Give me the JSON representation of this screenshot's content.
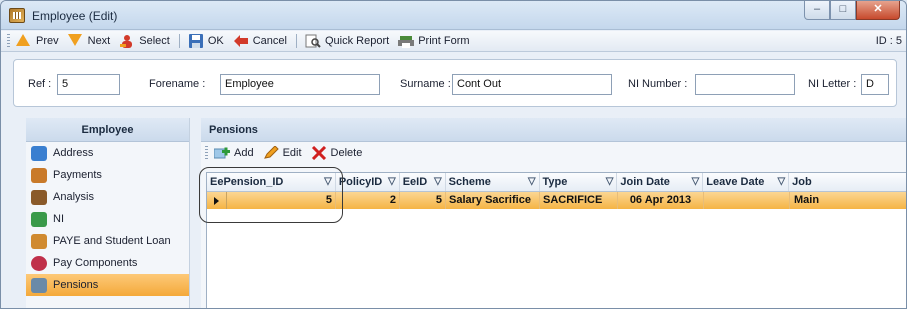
{
  "window": {
    "title": "Employee (Edit)",
    "id_label": "ID : 5"
  },
  "toolbar": {
    "prev": "Prev",
    "next": "Next",
    "select": "Select",
    "ok": "OK",
    "cancel": "Cancel",
    "quick_report": "Quick Report",
    "print_form": "Print Form"
  },
  "fields": {
    "ref_label": "Ref :",
    "ref_value": "5",
    "forename_label": "Forename :",
    "forename_value": "Employee",
    "surname_label": "Surname :",
    "surname_value": "Cont Out",
    "ni_number_label": "NI Number :",
    "ni_number_value": "",
    "ni_letter_label": "NI Letter :",
    "ni_letter_value": "D"
  },
  "sidebar": {
    "title": "Employee",
    "items": [
      {
        "label": "Address",
        "icon": "address-icon",
        "color": "#3a7fd0"
      },
      {
        "label": "Payments",
        "icon": "payments-icon",
        "color": "#c97a2a"
      },
      {
        "label": "Analysis",
        "icon": "analysis-icon",
        "color": "#8a5a2a"
      },
      {
        "label": "NI",
        "icon": "ni-icon",
        "color": "#3a9a4a"
      },
      {
        "label": "PAYE and Student Loan",
        "icon": "paye-icon",
        "color": "#d08a30"
      },
      {
        "label": "Pay Components",
        "icon": "pay-components-icon",
        "color": "#c0304a"
      },
      {
        "label": "Pensions",
        "icon": "pensions-icon",
        "color": "#6a8aa8"
      }
    ],
    "active": "Pensions"
  },
  "pensions": {
    "title": "Pensions",
    "add": "Add",
    "edit": "Edit",
    "delete": "Delete",
    "columns": [
      "EePension_ID",
      "PolicyID",
      "EeID",
      "Scheme",
      "Type",
      "Join Date",
      "Leave Date",
      "Job"
    ],
    "rows": [
      {
        "EePension_ID": "5",
        "PolicyID": "2",
        "EeID": "5",
        "Scheme": "Salary Sacrifice",
        "Type": "SACRIFICE",
        "Join Date": "06 Apr 2013",
        "Leave Date": "",
        "Job": "Main"
      }
    ]
  }
}
